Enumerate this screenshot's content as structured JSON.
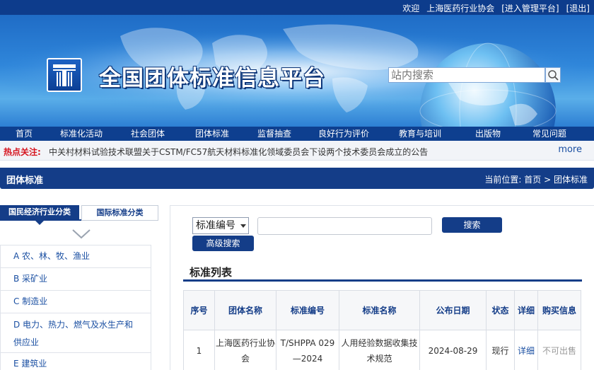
{
  "topbar": {
    "welcome": "欢迎",
    "user": "上海医药行业协会",
    "admin_link": "[进入管理平台]",
    "logout_link": "[退出]"
  },
  "header": {
    "site_title": "全国团体标准信息平台",
    "search_placeholder": "站内搜索"
  },
  "nav": [
    "首页",
    "标准化活动",
    "社会团体",
    "团体标准",
    "监督抽查",
    "良好行为评价",
    "教育与培训",
    "出版物",
    "常见问题"
  ],
  "hot": {
    "label": "热点关注:",
    "text": "中关村材料试验技术联盟关于CSTM/FC57航天材料标准化领域委员会下设两个技术委员会成立的公告",
    "more": "more"
  },
  "section": {
    "title": "团体标准",
    "crumb_label": "当前位置:",
    "crumb_home": "首页",
    "crumb_sep": ">",
    "crumb_current": "团体标准"
  },
  "left_tabs": {
    "active": "国民经济行业分类",
    "inactive": "国际标准分类"
  },
  "categories": [
    "A 农、林、牧、渔业",
    "B 采矿业",
    "C 制造业",
    "D 电力、热力、燃气及水生产和供应业",
    "E 建筑业"
  ],
  "search": {
    "select_value": "标准编号",
    "search_button": "搜索",
    "advanced_button": "高级搜索"
  },
  "list_title": "标准列表",
  "table": {
    "headers": [
      "序号",
      "团体名称",
      "标准编号",
      "标准名称",
      "公布日期",
      "状态",
      "详细",
      "购买信息"
    ],
    "rows": [
      {
        "idx": "1",
        "org": "上海医药行业协会",
        "code": "T/SHPPA 029—2024",
        "name": "人用经验数据收集技术规范",
        "date": "2024-08-29",
        "status": "现行",
        "detail": "详细",
        "buy": "不可出售"
      }
    ]
  }
}
